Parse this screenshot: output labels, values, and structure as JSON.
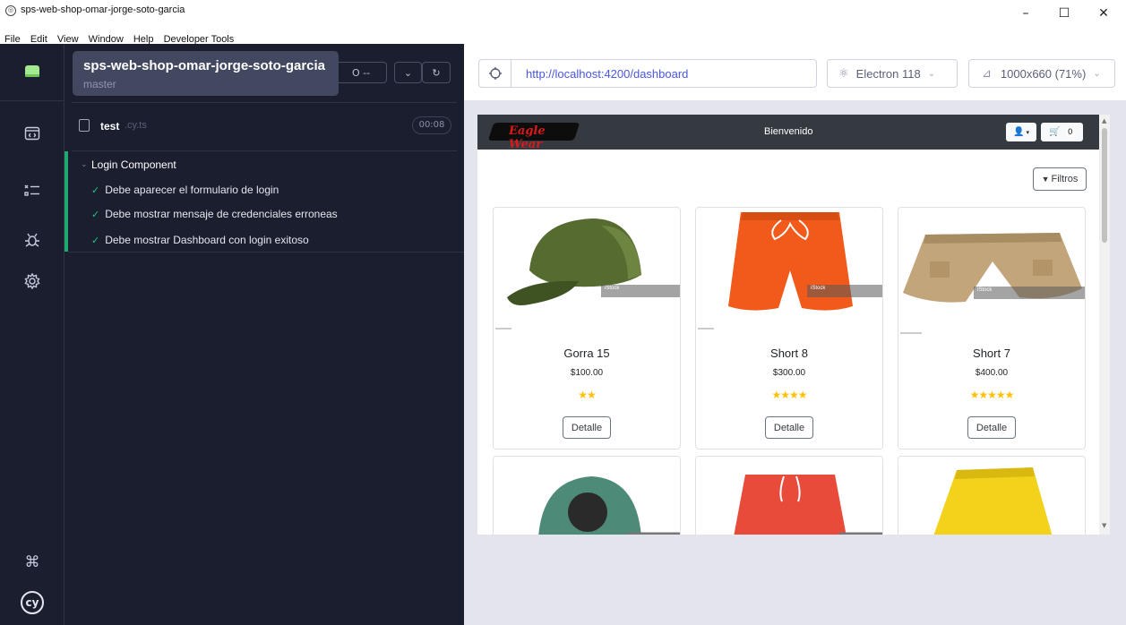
{
  "window": {
    "title": "sps-web-shop-omar-jorge-soto-garcia",
    "minimize": "–",
    "maximize": "☐",
    "close": "✕"
  },
  "menu": [
    "File",
    "Edit",
    "View",
    "Window",
    "Help",
    "Developer Tools"
  ],
  "rail": {
    "icons": [
      "project-icon",
      "specs-icon",
      "runs-icon",
      "debug-icon",
      "settings-icon",
      "keyboard-shortcuts-icon",
      "cypress-logo-icon"
    ],
    "logo_text": "cy"
  },
  "tooltip": {
    "project": "sps-web-shop-omar-jorge-soto-garcia",
    "branch": "master"
  },
  "controls": {
    "stats_partial": "O --"
  },
  "spec": {
    "name": "test",
    "ext": ".cy.ts",
    "duration": "00:08"
  },
  "suite": {
    "title": "Login Component",
    "tests": [
      "Debe aparecer el formulario de login",
      "Debe mostrar mensaje de credenciales erroneas",
      "Debe mostrar Dashboard con login exitoso"
    ]
  },
  "browserbar": {
    "url": "http://localhost:4200/dashboard",
    "browser": "Electron 118",
    "viewport": "1000x660 (71%)"
  },
  "app": {
    "brand": "Eagle Wear",
    "welcome": "Bienvenido",
    "cart_count": "0",
    "filter_label": "Filtros",
    "colors": {
      "navbar": "#343a40",
      "stars": "#ffc107",
      "pass": "#1fa971",
      "url": "#4956e3"
    },
    "products": [
      {
        "name": "Gorra 15",
        "price": "$100.00",
        "stars": "★★",
        "detail": "Detalle",
        "watermark": "iStock"
      },
      {
        "name": "Short 8",
        "price": "$300.00",
        "stars": "★★★★",
        "detail": "Detalle",
        "watermark": "iStock"
      },
      {
        "name": "Short 7",
        "price": "$400.00",
        "stars": "★★★★★",
        "detail": "Detalle",
        "watermark": "iStock"
      }
    ]
  }
}
